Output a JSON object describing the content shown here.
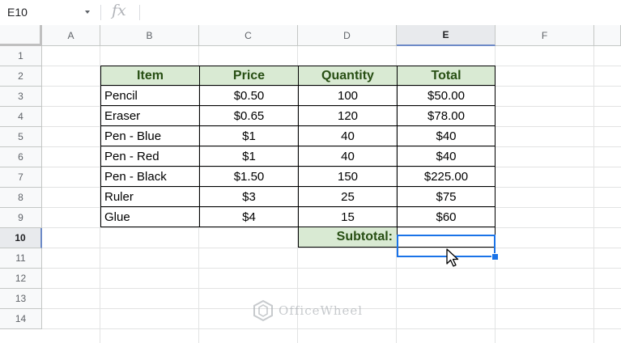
{
  "name_box": "E10",
  "formula_icon": "fx",
  "formula_value": "",
  "columns": [
    "A",
    "B",
    "C",
    "D",
    "E",
    "F"
  ],
  "rows": [
    "1",
    "2",
    "3",
    "4",
    "5",
    "6",
    "7",
    "8",
    "9",
    "10",
    "11",
    "12",
    "13",
    "14"
  ],
  "selected_column": "E",
  "selected_row": "10",
  "table": {
    "headers": [
      "Item",
      "Price",
      "Quantity",
      "Total"
    ],
    "rows": [
      [
        "Pencil",
        "$0.50",
        "100",
        "$50.00"
      ],
      [
        "Eraser",
        "$0.65",
        "120",
        "$78.00"
      ],
      [
        "Pen - Blue",
        "$1",
        "40",
        "$40"
      ],
      [
        "Pen - Red",
        "$1",
        "40",
        "$40"
      ],
      [
        "Pen - Black",
        "$1.50",
        "150",
        "$225.00"
      ],
      [
        "Ruler",
        "$3",
        "25",
        "$75"
      ],
      [
        "Glue",
        "$4",
        "15",
        "$60"
      ]
    ],
    "subtotal_label": "Subtotal:",
    "subtotal_value": ""
  },
  "colors": {
    "header_fill": "#d9ead3",
    "header_text": "#274e13",
    "selection": "#1a73e8"
  },
  "watermark": "OfficeWheel"
}
